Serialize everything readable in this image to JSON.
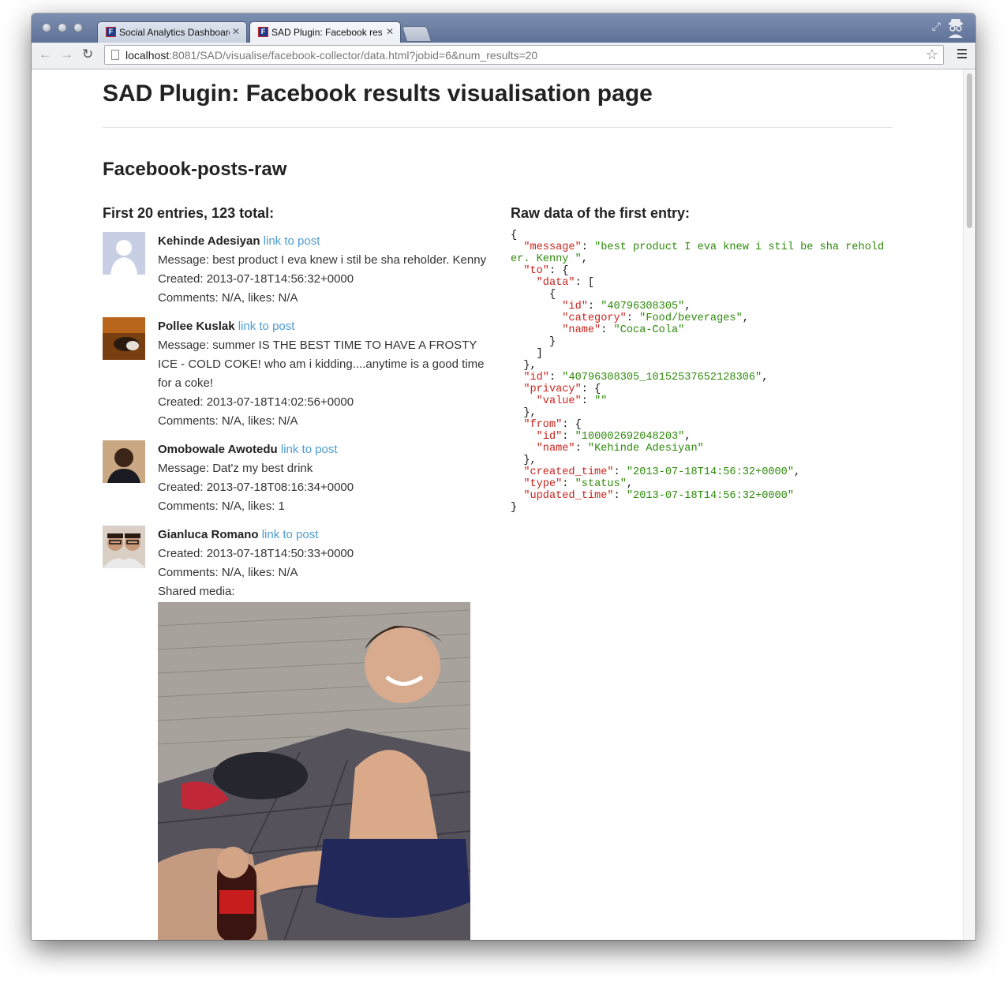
{
  "browser": {
    "tabs": [
      {
        "label": "Social Analytics Dashboard",
        "active": false
      },
      {
        "label": "SAD Plugin: Facebook resu",
        "active": true
      }
    ],
    "url_host": "localhost",
    "url_rest": ":8081/SAD/visualise/facebook-collector/data.html?jobid=6&num_results=20"
  },
  "page": {
    "title": "SAD Plugin: Facebook results visualisation page",
    "subtitle": "Facebook-posts-raw",
    "left_heading": "First 20 entries, 123 total:",
    "right_heading": "Raw data of the first entry:"
  },
  "posts": [
    {
      "name": "Kehinde Adesiyan",
      "link": "link to post",
      "message": "Message: best product I eva knew i stil be sha reholder. Kenny",
      "created": "Created: 2013-07-18T14:56:32+0000",
      "stats": "Comments: N/A, likes: N/A"
    },
    {
      "name": "Pollee Kuslak",
      "link": "link to post",
      "message": "Message: summer IS THE BEST TIME TO HAVE A FROSTY ICE - COLD COKE! who am i kidding....anytime is a good time for a coke!",
      "created": "Created: 2013-07-18T14:02:56+0000",
      "stats": "Comments: N/A, likes: N/A"
    },
    {
      "name": "Omobowale Awotedu",
      "link": "link to post",
      "message": "Message: Dat'z my best drink",
      "created": "Created: 2013-07-18T08:16:34+0000",
      "stats": "Comments: N/A, likes: 1"
    },
    {
      "name": "Gianluca Romano",
      "link": "link to post",
      "created": "Created: 2013-07-18T14:50:33+0000",
      "stats": "Comments: N/A, likes: N/A",
      "shared": "Shared media:"
    }
  ],
  "raw_json": {
    "message": "best product I eva knew i stil be sha reholder. Kenny ",
    "to_id": "40796308305",
    "to_category": "Food/beverages",
    "to_name": "Coca-Cola",
    "id": "40796308305_10152537652128306",
    "privacy_value": "",
    "from_id": "100002692048203",
    "from_name": "Kehinde Adesiyan",
    "created_time": "2013-07-18T14:56:32+0000",
    "type": "status",
    "updated_time": "2013-07-18T14:56:32+0000"
  },
  "icons": [
    "page-icon",
    "star-icon",
    "menu-icon",
    "back-icon",
    "forward-icon",
    "reload-icon"
  ]
}
